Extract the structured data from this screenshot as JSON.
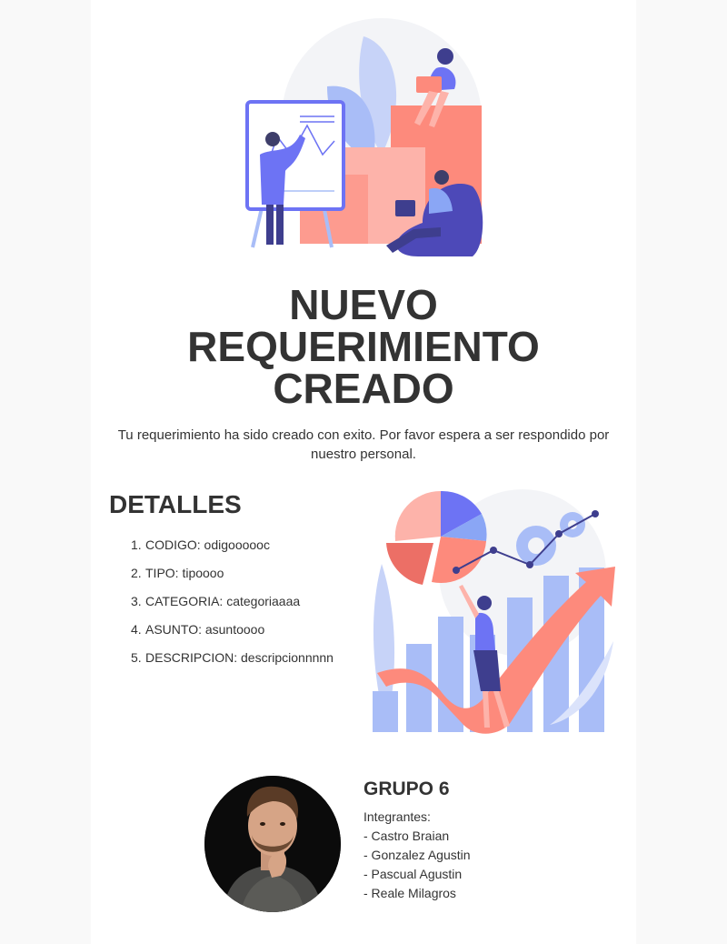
{
  "header": {
    "illustration_icon": "team-meeting-illustration",
    "title_lines": [
      "NUEVO",
      "REQUERIMIENTO",
      "CREADO"
    ],
    "intro": "Tu requerimiento ha sido creado con exito. Por favor espera a ser respondido por nuestro personal."
  },
  "details": {
    "title": "DETALLES",
    "items": [
      {
        "num": "1.",
        "text": "CODIGO: odigoooooc"
      },
      {
        "num": "2.",
        "text": "TIPO: tipoooo"
      },
      {
        "num": "3.",
        "text": "CATEGORIA: categoriaaaa"
      },
      {
        "num": "4.",
        "text": "ASUNTO: asuntoooo"
      },
      {
        "num": "5.",
        "text": "DESCRIPCION: descripcionnnnn"
      }
    ],
    "illustration_icon": "business-growth-chart-illustration"
  },
  "group": {
    "avatar_icon": "man-portrait-photo",
    "title": "GRUPO 6",
    "members_label": "Integrantes:",
    "members": [
      "- Castro Braian",
      "- Gonzalez Agustin",
      "- Pascual Agustin",
      "- Reale Milagros"
    ]
  },
  "colors": {
    "page_background": "#f9f9f9",
    "card_background": "#ffffff",
    "text": "#333333",
    "accent_blue": "#6d73f4",
    "accent_coral": "#fd8a7c",
    "accent_light_blue": "#a9bdf7"
  }
}
